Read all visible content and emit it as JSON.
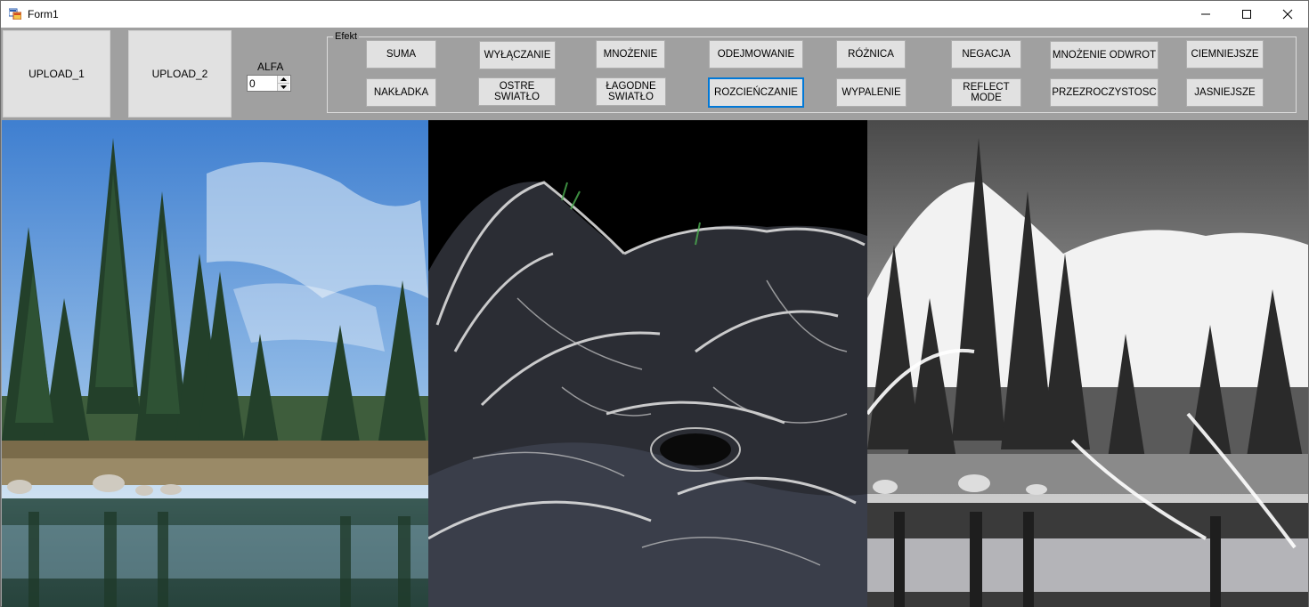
{
  "window": {
    "title": "Form1"
  },
  "buttons": {
    "upload1": "UPLOAD_1",
    "upload2": "UPLOAD_2"
  },
  "alfa": {
    "label": "ALFA",
    "value": "0"
  },
  "group": {
    "label": "Efekt",
    "row1": [
      "SUMA",
      "WYŁĄCZANIE",
      "MNOŻENIE",
      "ODEJMOWANIE",
      "RÓŻNICA",
      "NEGACJA",
      "MNOŻENIE ODWROT",
      "CIEMNIEJSZE"
    ],
    "row2": [
      "NAKŁADKA",
      "OSTRE\nSWIATŁO",
      "ŁAGODNE\nSWIATŁO",
      "ROZCIEŃCZANIE",
      "WYPALENIE",
      "REFLECT\nMODE",
      "PRZEZROCZYSTOSC",
      "JASNIEJSZE"
    ]
  },
  "colors": {
    "focus": "#0078d7",
    "form_bg": "#a0a0a0",
    "button_bg": "#e1e1e1"
  },
  "icons": [
    "app-icon",
    "minimize-icon",
    "maximize-icon",
    "close-icon",
    "spin-up-icon",
    "spin-down-icon"
  ]
}
